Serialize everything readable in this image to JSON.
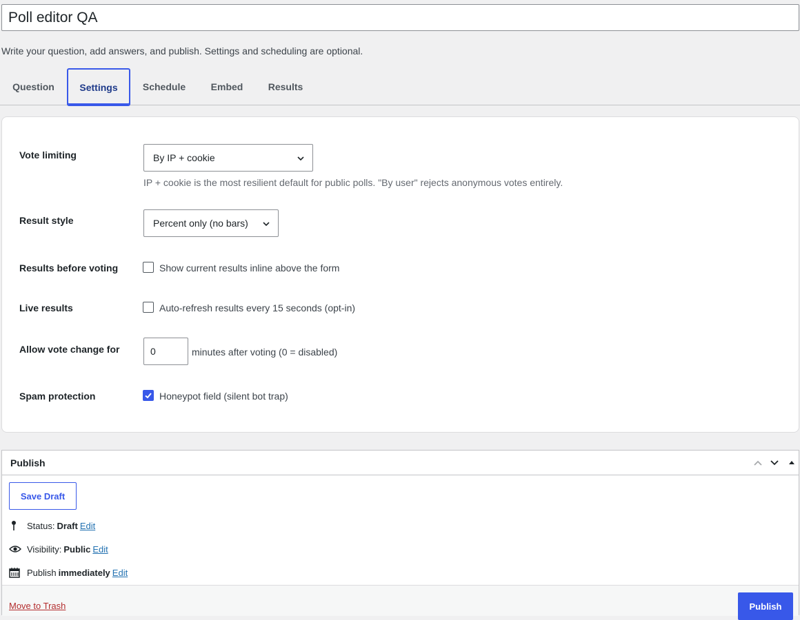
{
  "title_field": {
    "value": "Poll editor QA"
  },
  "intro_text": "Write your question, add answers, and publish. Settings and scheduling are optional.",
  "tabs": [
    {
      "label": "Question"
    },
    {
      "label": "Settings",
      "active": true
    },
    {
      "label": "Schedule"
    },
    {
      "label": "Embed"
    },
    {
      "label": "Results"
    }
  ],
  "settings": {
    "vote_limiting": {
      "label": "Vote limiting",
      "selected": "By IP + cookie",
      "help": "IP + cookie is the most resilient default for public polls. \"By user\" rejects anonymous votes entirely."
    },
    "result_style": {
      "label": "Result style",
      "selected": "Percent only (no bars)"
    },
    "results_before_voting": {
      "label": "Results before voting",
      "checkbox_label": "Show current results inline above the form",
      "checked": false
    },
    "live_results": {
      "label": "Live results",
      "checkbox_label": "Auto-refresh results every 15 seconds (opt-in)",
      "checked": false
    },
    "allow_vote_change": {
      "label": "Allow vote change for",
      "value": "0",
      "suffix": "minutes after voting (0 = disabled)"
    },
    "spam_protection": {
      "label": "Spam protection",
      "checkbox_label": "Honeypot field (silent bot trap)",
      "checked": true
    }
  },
  "publish_box": {
    "title": "Publish",
    "save_draft_label": "Save Draft",
    "status": {
      "prefix": "Status:",
      "value": "Draft",
      "edit": "Edit"
    },
    "visibility": {
      "prefix": "Visibility:",
      "value": "Public",
      "edit": "Edit"
    },
    "schedule": {
      "prefix": "Publish",
      "value": "immediately",
      "edit": "Edit"
    },
    "trash_label": "Move to Trash",
    "publish_label": "Publish"
  },
  "colors": {
    "accent": "#3858e9",
    "danger": "#b32d2e",
    "link": "#2271b1"
  }
}
